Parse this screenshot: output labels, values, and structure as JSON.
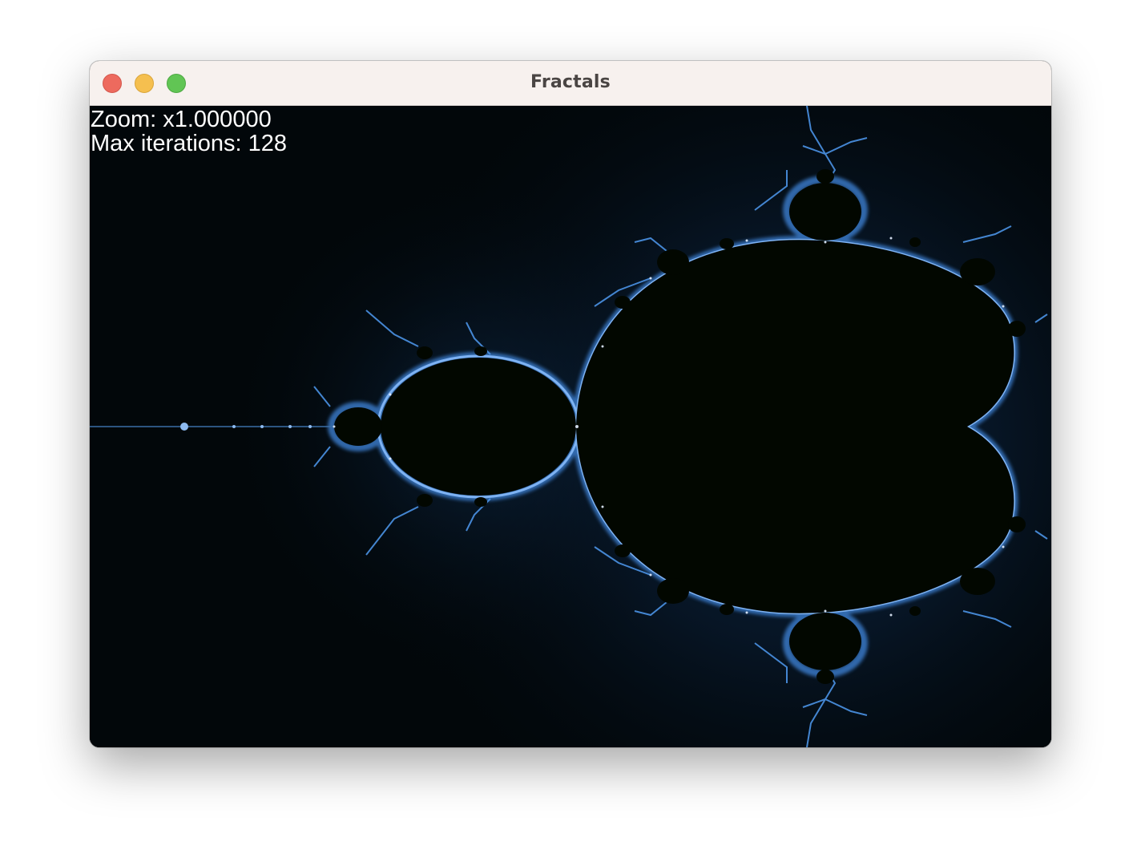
{
  "window": {
    "title": "Fractals"
  },
  "overlay": {
    "zoom_text": "Zoom: x1.000000",
    "iterations_text": "Max iterations: 128"
  },
  "fractal": {
    "type": "mandelbrot",
    "set_color": "#020700",
    "background_color": "#02070a",
    "glow_color": "#1b4a8a",
    "edge_color": "#5aa0f0",
    "highlight_color": "#dbe9ff"
  },
  "colors": {
    "titlebar_bg": "#f7f1ee",
    "close": "#ed6a5e",
    "minimize": "#f5bf4f",
    "zoom": "#61c554"
  }
}
